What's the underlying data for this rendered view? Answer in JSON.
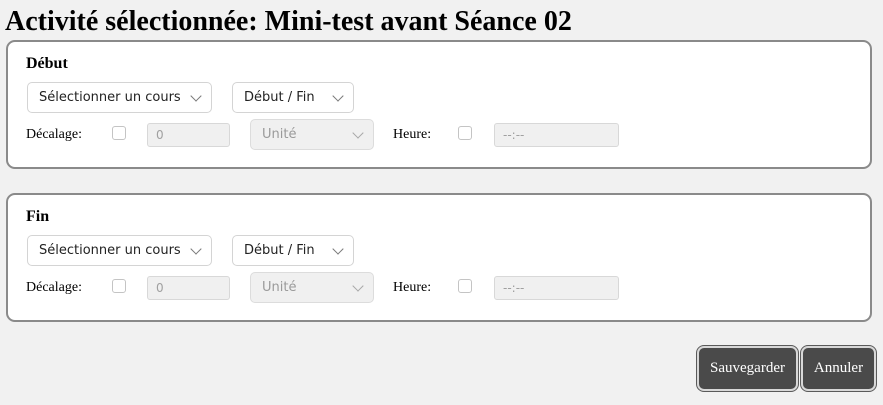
{
  "page": {
    "title": "Activité sélectionnée: Mini-test avant Séance 02"
  },
  "sections": [
    {
      "title": "Début",
      "course_select": "Sélectionner un cours",
      "range_select": "Début / Fin",
      "offset_label": "Décalage:",
      "offset_checked": false,
      "offset_value": "0",
      "unit_select": "Unité",
      "hour_label": "Heure:",
      "hour_checked": false,
      "time_value": "--:--"
    },
    {
      "title": "Fin",
      "course_select": "Sélectionner un cours",
      "range_select": "Début / Fin",
      "offset_label": "Décalage:",
      "offset_checked": false,
      "offset_value": "0",
      "unit_select": "Unité",
      "hour_label": "Heure:",
      "hour_checked": false,
      "time_value": "--:--"
    }
  ],
  "actions": {
    "save_label": "Sauvegarder",
    "cancel_label": "Annuler"
  },
  "colors": {
    "button_bg": "#4a4a4a",
    "panel_border": "#8a8a8a",
    "page_bg": "#f1f1f1"
  },
  "icons": {
    "dropdown": "chevron-down-icon"
  }
}
